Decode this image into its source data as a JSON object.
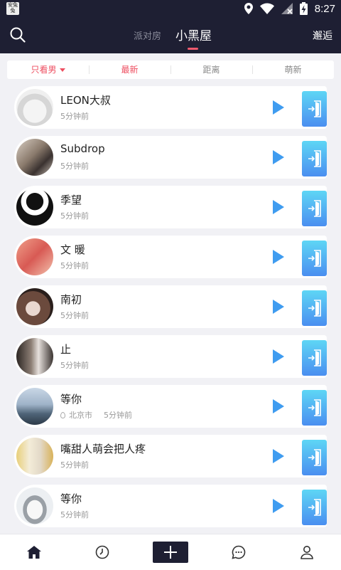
{
  "status_bar": {
    "time": "8:27",
    "app_icon_text": "安兔兔"
  },
  "header": {
    "search_icon": "search-icon",
    "tab_inactive": "派对房",
    "tab_active": "小黑屋",
    "right_action": "邂逅"
  },
  "filters": [
    {
      "label": "只看男",
      "active": true
    },
    {
      "label": "最新",
      "active": true
    },
    {
      "label": "距离",
      "active": false
    },
    {
      "label": "萌新",
      "active": false
    }
  ],
  "users": [
    {
      "name": "LEON大叔",
      "location": "",
      "time": "5分钟前"
    },
    {
      "name": "Subdrop",
      "location": "",
      "time": "5分钟前"
    },
    {
      "name": "季望",
      "location": "",
      "time": "5分钟前"
    },
    {
      "name": "文  暖",
      "location": "",
      "time": "5分钟前"
    },
    {
      "name": "南初",
      "location": "",
      "time": "5分钟前"
    },
    {
      "name": "止",
      "location": "",
      "time": "5分钟前"
    },
    {
      "name": "等你",
      "location": "北京市",
      "time": "5分钟前"
    },
    {
      "name": "嘴甜人萌会把人疼",
      "location": "",
      "time": "5分钟前"
    },
    {
      "name": "等你",
      "location": "",
      "time": "5分钟前"
    }
  ],
  "bottom_nav": [
    "home-icon",
    "clock-icon",
    "plus-icon",
    "chat-icon",
    "profile-icon"
  ],
  "colors": {
    "header_bg": "#1e1f33",
    "accent_red": "#ee4e60",
    "play_blue": "#3f9cf0"
  }
}
